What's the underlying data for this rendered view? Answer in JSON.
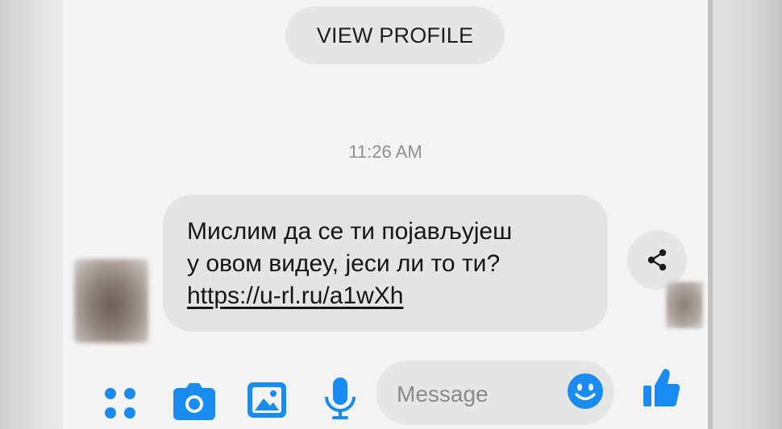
{
  "header": {
    "view_profile_label": "VIEW PROFILE"
  },
  "conversation": {
    "timestamp": "11:26 AM",
    "message": {
      "lines": [
        "Мислим да се ти појављујеш",
        "у овом видеу, јеси ли то ти?"
      ],
      "link": "https://u-rl.ru/a1wXh"
    }
  },
  "composer": {
    "placeholder": "Message"
  },
  "icons": {
    "apps": "apps-grid-icon",
    "camera": "camera-icon",
    "gallery": "gallery-icon",
    "mic": "microphone-icon",
    "emoji": "emoji-icon",
    "like": "thumbs-up-icon",
    "share": "share-icon"
  },
  "colors": {
    "accent": "#1a8cf0",
    "bubble": "#e4e4e4",
    "background": "#f4f4f4"
  }
}
